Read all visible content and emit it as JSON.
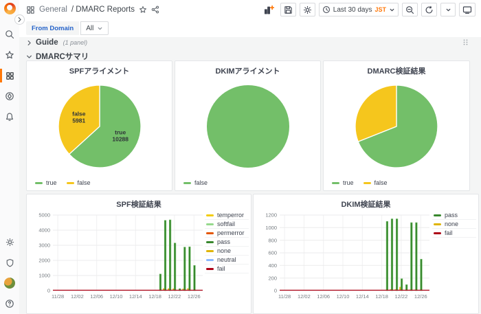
{
  "nav": {
    "breadcrumb_section": "General",
    "breadcrumb_page": "/ DMARC Reports",
    "time_label": "Last 30 days",
    "timezone": "JST"
  },
  "filters": {
    "from_domain_label": "From Domain",
    "from_domain_value": "All"
  },
  "rows": {
    "guide_title": "Guide",
    "guide_count": "(1 panel)",
    "summary_title": "DMARCサマリ"
  },
  "icons": {
    "sidebar_top": [
      "grafana-logo",
      "search",
      "star",
      "dashboards",
      "explore",
      "alerting"
    ],
    "sidebar_bottom": [
      "configuration",
      "server-admin",
      "profile",
      "help"
    ],
    "nav_left": [
      "dashboard-grid",
      "star-outline",
      "share"
    ],
    "nav_right": [
      "panel-add",
      "save",
      "settings",
      "clock",
      "zoom-out",
      "refresh",
      "caret-down",
      "tv"
    ]
  },
  "colors": {
    "accent": "#FF780A",
    "link_blue": "#2563C9",
    "green": "#73BF69",
    "dark_green": "#37872D",
    "yellow": "#F5C61D",
    "dark_yellow": "#E0B400",
    "red": "#AD0317"
  },
  "chart_data": [
    {
      "type": "pie",
      "title": "SPFアライメント",
      "slices": [
        {
          "label": "true",
          "value": 10288,
          "color": "#73BF69",
          "show_label": true
        },
        {
          "label": "false",
          "value": 5981,
          "color": "#F5C61D",
          "show_label": true
        }
      ],
      "legend_position": "bottom"
    },
    {
      "type": "pie",
      "title": "DKIMアライメント",
      "slices": [
        {
          "label": "false",
          "value": 100,
          "color": "#73BF69",
          "show_label": false
        }
      ],
      "legend_position": "bottom"
    },
    {
      "type": "pie",
      "title": "DMARC検証結果",
      "slices": [
        {
          "label": "true",
          "value": 69,
          "color": "#73BF69",
          "show_label": false
        },
        {
          "label": "false",
          "value": 31,
          "color": "#F5C61D",
          "show_label": false
        }
      ],
      "legend_position": "bottom"
    },
    {
      "type": "bar",
      "title": "SPF検証結果",
      "ylim": [
        0,
        5000
      ],
      "yticks": [
        0,
        1000,
        2000,
        3000,
        4000,
        5000
      ],
      "xtick_labels": [
        "11/28",
        "12/02",
        "12/06",
        "12/10",
        "12/14",
        "12/18",
        "12/22",
        "12/26"
      ],
      "xtick_days": [
        0,
        4,
        8,
        12,
        16,
        20,
        24,
        28
      ],
      "legend": [
        {
          "label": "temperror",
          "color": "#F2CC0C"
        },
        {
          "label": "softfail",
          "color": "#96D98D"
        },
        {
          "label": "permerror",
          "color": "#E45705"
        },
        {
          "label": "pass",
          "color": "#37872D"
        },
        {
          "label": "none",
          "color": "#E0B400"
        },
        {
          "label": "neutral",
          "color": "#8AB8FF"
        },
        {
          "label": "fail",
          "color": "#AD0317"
        }
      ],
      "bar_series": [
        "none",
        "pass"
      ],
      "bars": [
        {
          "day": 21,
          "date": "12/19",
          "values": {
            "pass": 1100,
            "none": 40
          }
        },
        {
          "day": 22,
          "date": "12/20",
          "values": {
            "pass": 4650,
            "none": 150
          }
        },
        {
          "day": 23,
          "date": "12/21",
          "values": {
            "pass": 4680,
            "none": 150
          }
        },
        {
          "day": 24,
          "date": "12/22",
          "values": {
            "pass": 3150,
            "none": 140
          }
        },
        {
          "day": 25,
          "date": "12/23",
          "values": {
            "pass": 130,
            "none": 20
          }
        },
        {
          "day": 26,
          "date": "12/24",
          "values": {
            "pass": 2880,
            "none": 130
          }
        },
        {
          "day": 27,
          "date": "12/25",
          "values": {
            "pass": 2900,
            "none": 160
          }
        },
        {
          "day": 28,
          "date": "12/26",
          "values": {
            "pass": 1670,
            "none": 40
          }
        }
      ],
      "zero_line_series": "fail",
      "zero_line_color": "#AD0317"
    },
    {
      "type": "bar",
      "title": "DKIM検証結果",
      "ylim": [
        0,
        1200
      ],
      "yticks": [
        0,
        200,
        400,
        600,
        800,
        1000,
        1200
      ],
      "xtick_labels": [
        "11/28",
        "12/02",
        "12/06",
        "12/10",
        "12/14",
        "12/18",
        "12/22",
        "12/26"
      ],
      "xtick_days": [
        0,
        4,
        8,
        12,
        16,
        20,
        24,
        28
      ],
      "legend": [
        {
          "label": "pass",
          "color": "#37872D"
        },
        {
          "label": "none",
          "color": "#E0B400"
        },
        {
          "label": "fail",
          "color": "#AD0317"
        }
      ],
      "bar_series": [
        "none",
        "pass"
      ],
      "bars": [
        {
          "day": 21,
          "date": "12/19",
          "values": {
            "pass": 1100,
            "none": 10
          }
        },
        {
          "day": 22,
          "date": "12/20",
          "values": {
            "pass": 1140,
            "none": 20
          }
        },
        {
          "day": 23,
          "date": "12/21",
          "values": {
            "pass": 1140,
            "none": 20
          }
        },
        {
          "day": 24,
          "date": "12/22",
          "values": {
            "pass": 190,
            "none": 60
          }
        },
        {
          "day": 25,
          "date": "12/23",
          "values": {
            "pass": 95,
            "none": 10
          }
        },
        {
          "day": 26,
          "date": "12/24",
          "values": {
            "pass": 1080,
            "none": 15
          }
        },
        {
          "day": 27,
          "date": "12/25",
          "values": {
            "pass": 1080,
            "none": 15
          }
        },
        {
          "day": 28,
          "date": "12/26",
          "values": {
            "pass": 500,
            "none": 10
          }
        }
      ],
      "zero_line_series": "fail",
      "zero_line_color": "#AD0317"
    }
  ]
}
